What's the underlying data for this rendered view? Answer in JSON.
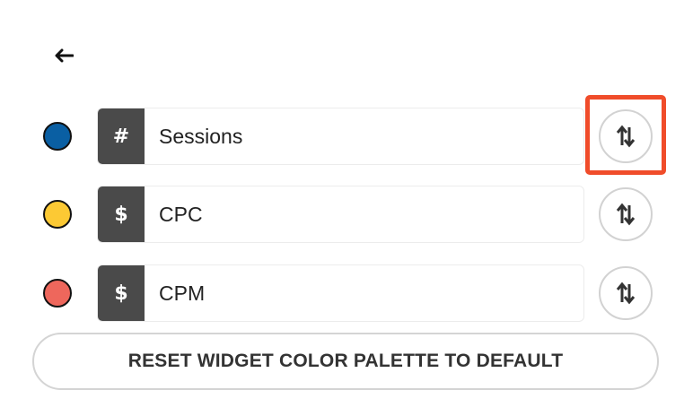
{
  "back": {
    "icon": "arrow-left-icon"
  },
  "metrics": [
    {
      "symbol": "#",
      "name": "Sessions",
      "color": "#0a5fa3"
    },
    {
      "symbol": "$",
      "name": "CPC",
      "color": "#fcc934"
    },
    {
      "symbol": "$",
      "name": "CPM",
      "color": "#ee675c"
    }
  ],
  "sort_icon": "sort-up-down-icon",
  "highlight_color": "#f04c2a",
  "reset_button_label": "RESET WIDGET COLOR PALETTE TO DEFAULT"
}
